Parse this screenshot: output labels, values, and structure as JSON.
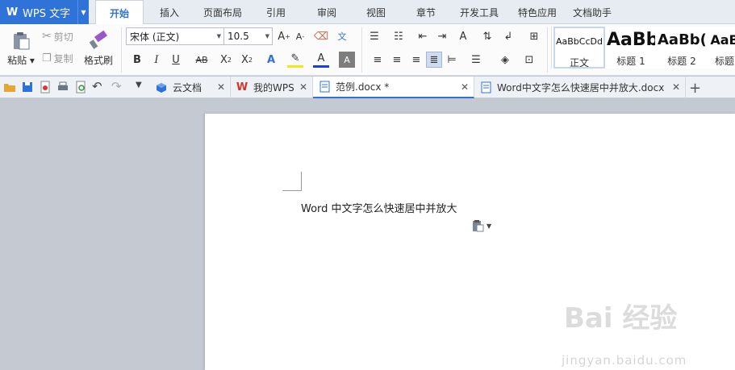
{
  "app": {
    "name": "WPS 文字"
  },
  "menu": {
    "tabs": [
      {
        "label": "开始"
      },
      {
        "label": "插入"
      },
      {
        "label": "页面布局"
      },
      {
        "label": "引用"
      },
      {
        "label": "审阅"
      },
      {
        "label": "视图"
      },
      {
        "label": "章节"
      },
      {
        "label": "开发工具"
      },
      {
        "label": "特色应用"
      },
      {
        "label": "文档助手"
      }
    ]
  },
  "ribbon": {
    "paste_label": "粘贴",
    "cut_label": "剪切",
    "copy_label": "复制",
    "format_painter_label": "格式刷",
    "font_name": "宋体 (正文)",
    "font_size": "10.5",
    "styles": [
      {
        "sample": "AaBbCcDd",
        "name": "正文"
      },
      {
        "sample": "AaBb",
        "name": "标题 1"
      },
      {
        "sample": "AaBb(",
        "name": "标题 2"
      },
      {
        "sample": "AaB",
        "name": "标题"
      }
    ]
  },
  "tabs": [
    {
      "label": "云文档"
    },
    {
      "label": "我的WPS"
    },
    {
      "label": "范例.docx *"
    },
    {
      "label": "Word中文字怎么快速居中并放大.docx"
    }
  ],
  "document": {
    "text": "Word 中文字怎么快速居中并放大"
  },
  "watermark": {
    "brand": "Bai 经验",
    "url": "jingyan.baidu.com"
  },
  "colors": {
    "accent": "#2f73d9",
    "font_color_underline": "#1a3fe0",
    "highlight_underline": "#f5e61a"
  }
}
